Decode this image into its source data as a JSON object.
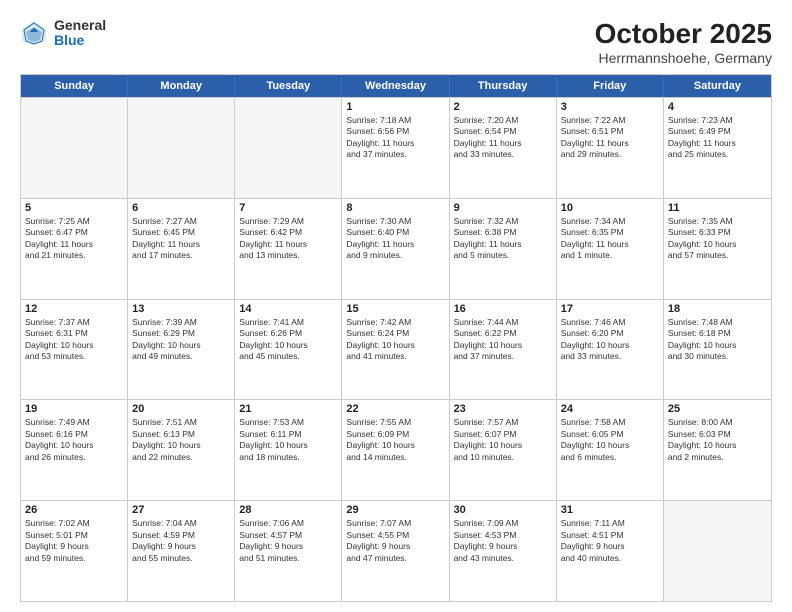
{
  "logo": {
    "general": "General",
    "blue": "Blue"
  },
  "title": "October 2025",
  "location": "Herrmannshoehe, Germany",
  "weekdays": [
    "Sunday",
    "Monday",
    "Tuesday",
    "Wednesday",
    "Thursday",
    "Friday",
    "Saturday"
  ],
  "rows": [
    [
      {
        "day": "",
        "empty": true
      },
      {
        "day": "",
        "empty": true
      },
      {
        "day": "",
        "empty": true
      },
      {
        "day": "1",
        "lines": [
          "Sunrise: 7:18 AM",
          "Sunset: 6:56 PM",
          "Daylight: 11 hours",
          "and 37 minutes."
        ]
      },
      {
        "day": "2",
        "lines": [
          "Sunrise: 7:20 AM",
          "Sunset: 6:54 PM",
          "Daylight: 11 hours",
          "and 33 minutes."
        ]
      },
      {
        "day": "3",
        "lines": [
          "Sunrise: 7:22 AM",
          "Sunset: 6:51 PM",
          "Daylight: 11 hours",
          "and 29 minutes."
        ]
      },
      {
        "day": "4",
        "lines": [
          "Sunrise: 7:23 AM",
          "Sunset: 6:49 PM",
          "Daylight: 11 hours",
          "and 25 minutes."
        ]
      }
    ],
    [
      {
        "day": "5",
        "lines": [
          "Sunrise: 7:25 AM",
          "Sunset: 6:47 PM",
          "Daylight: 11 hours",
          "and 21 minutes."
        ]
      },
      {
        "day": "6",
        "lines": [
          "Sunrise: 7:27 AM",
          "Sunset: 6:45 PM",
          "Daylight: 11 hours",
          "and 17 minutes."
        ]
      },
      {
        "day": "7",
        "lines": [
          "Sunrise: 7:29 AM",
          "Sunset: 6:42 PM",
          "Daylight: 11 hours",
          "and 13 minutes."
        ]
      },
      {
        "day": "8",
        "lines": [
          "Sunrise: 7:30 AM",
          "Sunset: 6:40 PM",
          "Daylight: 11 hours",
          "and 9 minutes."
        ]
      },
      {
        "day": "9",
        "lines": [
          "Sunrise: 7:32 AM",
          "Sunset: 6:38 PM",
          "Daylight: 11 hours",
          "and 5 minutes."
        ]
      },
      {
        "day": "10",
        "lines": [
          "Sunrise: 7:34 AM",
          "Sunset: 6:35 PM",
          "Daylight: 11 hours",
          "and 1 minute."
        ]
      },
      {
        "day": "11",
        "lines": [
          "Sunrise: 7:35 AM",
          "Sunset: 6:33 PM",
          "Daylight: 10 hours",
          "and 57 minutes."
        ]
      }
    ],
    [
      {
        "day": "12",
        "lines": [
          "Sunrise: 7:37 AM",
          "Sunset: 6:31 PM",
          "Daylight: 10 hours",
          "and 53 minutes."
        ]
      },
      {
        "day": "13",
        "lines": [
          "Sunrise: 7:39 AM",
          "Sunset: 6:29 PM",
          "Daylight: 10 hours",
          "and 49 minutes."
        ]
      },
      {
        "day": "14",
        "lines": [
          "Sunrise: 7:41 AM",
          "Sunset: 6:26 PM",
          "Daylight: 10 hours",
          "and 45 minutes."
        ]
      },
      {
        "day": "15",
        "lines": [
          "Sunrise: 7:42 AM",
          "Sunset: 6:24 PM",
          "Daylight: 10 hours",
          "and 41 minutes."
        ]
      },
      {
        "day": "16",
        "lines": [
          "Sunrise: 7:44 AM",
          "Sunset: 6:22 PM",
          "Daylight: 10 hours",
          "and 37 minutes."
        ]
      },
      {
        "day": "17",
        "lines": [
          "Sunrise: 7:46 AM",
          "Sunset: 6:20 PM",
          "Daylight: 10 hours",
          "and 33 minutes."
        ]
      },
      {
        "day": "18",
        "lines": [
          "Sunrise: 7:48 AM",
          "Sunset: 6:18 PM",
          "Daylight: 10 hours",
          "and 30 minutes."
        ]
      }
    ],
    [
      {
        "day": "19",
        "lines": [
          "Sunrise: 7:49 AM",
          "Sunset: 6:16 PM",
          "Daylight: 10 hours",
          "and 26 minutes."
        ]
      },
      {
        "day": "20",
        "lines": [
          "Sunrise: 7:51 AM",
          "Sunset: 6:13 PM",
          "Daylight: 10 hours",
          "and 22 minutes."
        ]
      },
      {
        "day": "21",
        "lines": [
          "Sunrise: 7:53 AM",
          "Sunset: 6:11 PM",
          "Daylight: 10 hours",
          "and 18 minutes."
        ]
      },
      {
        "day": "22",
        "lines": [
          "Sunrise: 7:55 AM",
          "Sunset: 6:09 PM",
          "Daylight: 10 hours",
          "and 14 minutes."
        ]
      },
      {
        "day": "23",
        "lines": [
          "Sunrise: 7:57 AM",
          "Sunset: 6:07 PM",
          "Daylight: 10 hours",
          "and 10 minutes."
        ]
      },
      {
        "day": "24",
        "lines": [
          "Sunrise: 7:58 AM",
          "Sunset: 6:05 PM",
          "Daylight: 10 hours",
          "and 6 minutes."
        ]
      },
      {
        "day": "25",
        "lines": [
          "Sunrise: 8:00 AM",
          "Sunset: 6:03 PM",
          "Daylight: 10 hours",
          "and 2 minutes."
        ]
      }
    ],
    [
      {
        "day": "26",
        "lines": [
          "Sunrise: 7:02 AM",
          "Sunset: 5:01 PM",
          "Daylight: 9 hours",
          "and 59 minutes."
        ]
      },
      {
        "day": "27",
        "lines": [
          "Sunrise: 7:04 AM",
          "Sunset: 4:59 PM",
          "Daylight: 9 hours",
          "and 55 minutes."
        ]
      },
      {
        "day": "28",
        "lines": [
          "Sunrise: 7:06 AM",
          "Sunset: 4:57 PM",
          "Daylight: 9 hours",
          "and 51 minutes."
        ]
      },
      {
        "day": "29",
        "lines": [
          "Sunrise: 7:07 AM",
          "Sunset: 4:55 PM",
          "Daylight: 9 hours",
          "and 47 minutes."
        ]
      },
      {
        "day": "30",
        "lines": [
          "Sunrise: 7:09 AM",
          "Sunset: 4:53 PM",
          "Daylight: 9 hours",
          "and 43 minutes."
        ]
      },
      {
        "day": "31",
        "lines": [
          "Sunrise: 7:11 AM",
          "Sunset: 4:51 PM",
          "Daylight: 9 hours",
          "and 40 minutes."
        ]
      },
      {
        "day": "",
        "empty": true
      }
    ]
  ]
}
